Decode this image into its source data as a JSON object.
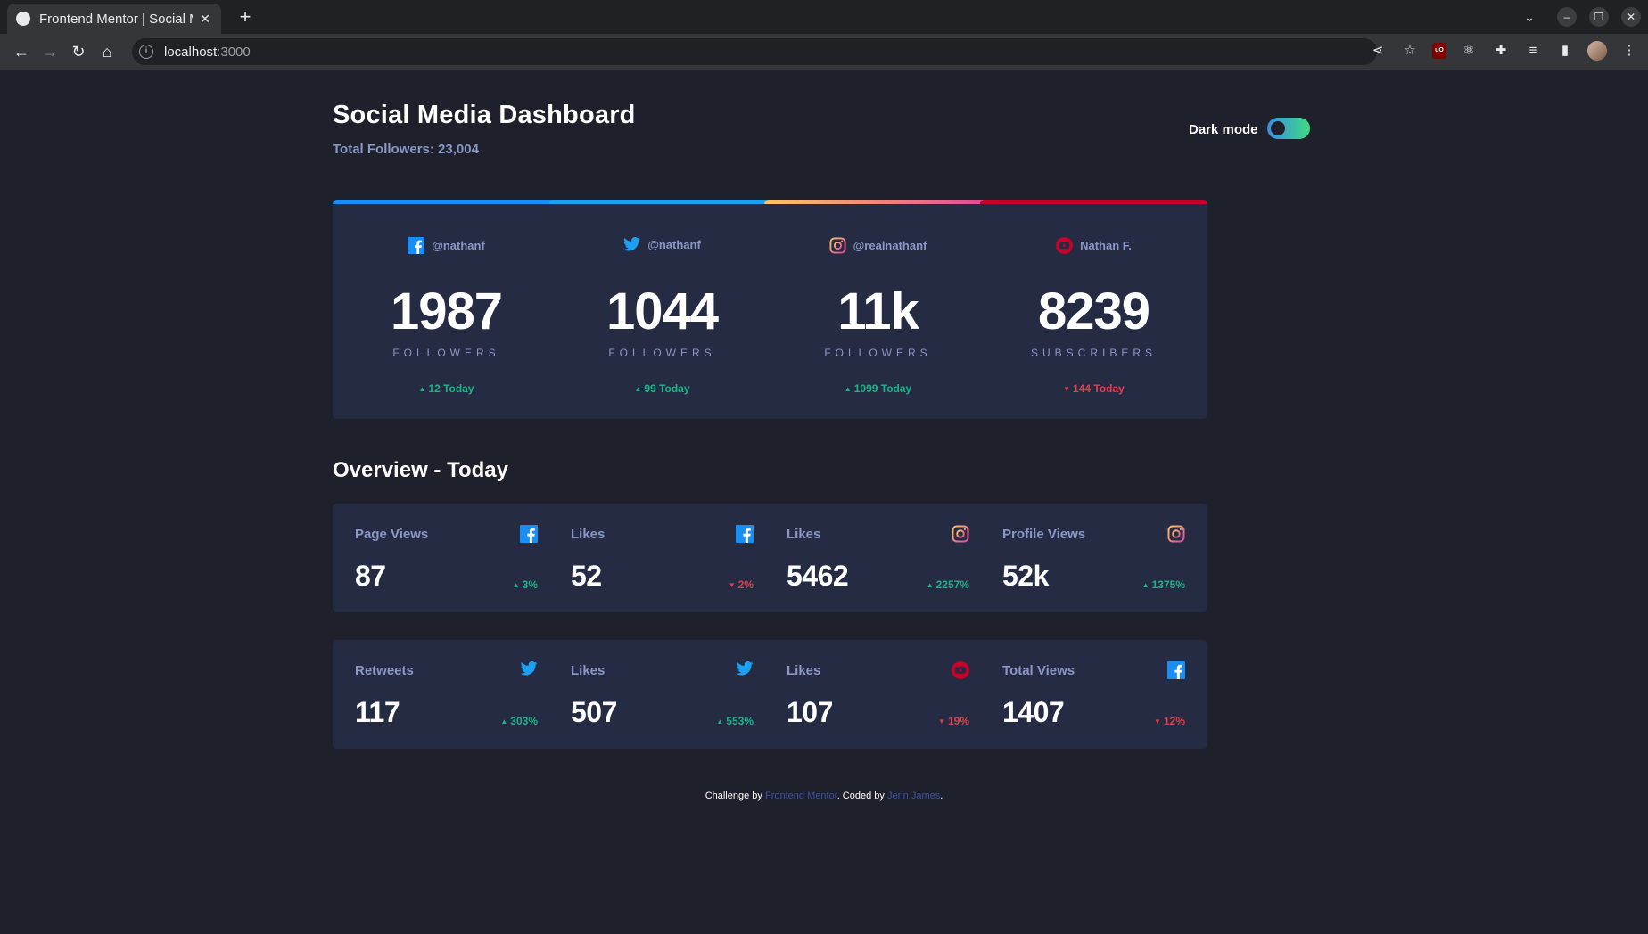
{
  "browser": {
    "tab_title": "Frontend Mentor | Social Media Dashboard",
    "tab_close": "✕",
    "new_tab": "+",
    "url_host": "localhost",
    "url_port": ":3000"
  },
  "header": {
    "title": "Social Media Dashboard",
    "total_followers": "Total Followers: 23,004",
    "toggle_label": "Dark mode",
    "dark_mode_on": true
  },
  "follower_cards": [
    {
      "platform": "facebook",
      "handle": "@nathanf",
      "count": "1987",
      "label": "FOLLOWERS",
      "change": "12 Today",
      "trend": "up"
    },
    {
      "platform": "twitter",
      "handle": "@nathanf",
      "count": "1044",
      "label": "FOLLOWERS",
      "change": "99 Today",
      "trend": "up"
    },
    {
      "platform": "instagram",
      "handle": "@realnathanf",
      "count": "11k",
      "label": "FOLLOWERS",
      "change": "1099 Today",
      "trend": "up"
    },
    {
      "platform": "youtube",
      "handle": "Nathan F.",
      "count": "8239",
      "label": "SUBSCRIBERS",
      "change": "144 Today",
      "trend": "down"
    }
  ],
  "overview": {
    "title": "Overview - Today",
    "cards": [
      {
        "label": "Page Views",
        "platform": "facebook",
        "value": "87",
        "change": "3%",
        "trend": "up"
      },
      {
        "label": "Likes",
        "platform": "facebook",
        "value": "52",
        "change": "2%",
        "trend": "down"
      },
      {
        "label": "Likes",
        "platform": "instagram",
        "value": "5462",
        "change": "2257%",
        "trend": "up"
      },
      {
        "label": "Profile Views",
        "platform": "instagram",
        "value": "52k",
        "change": "1375%",
        "trend": "up"
      },
      {
        "label": "Retweets",
        "platform": "twitter",
        "value": "117",
        "change": "303%",
        "trend": "up"
      },
      {
        "label": "Likes",
        "platform": "twitter",
        "value": "507",
        "change": "553%",
        "trend": "up"
      },
      {
        "label": "Likes",
        "platform": "youtube",
        "value": "107",
        "change": "19%",
        "trend": "down"
      },
      {
        "label": "Total Views",
        "platform": "facebook",
        "value": "1407",
        "change": "12%",
        "trend": "down"
      }
    ]
  },
  "footer": {
    "prefix": "Challenge by ",
    "link1": "Frontend Mentor",
    "middle": ". Coded by ",
    "link2": "Jerin James",
    "suffix": "."
  },
  "colors": {
    "facebook": "#198ff5",
    "twitter": "#1ca0f2",
    "instagram_start": "#fdc468",
    "instagram_end": "#df4996",
    "youtube": "#c4032b",
    "up": "#1db489",
    "down": "#dc414c"
  }
}
